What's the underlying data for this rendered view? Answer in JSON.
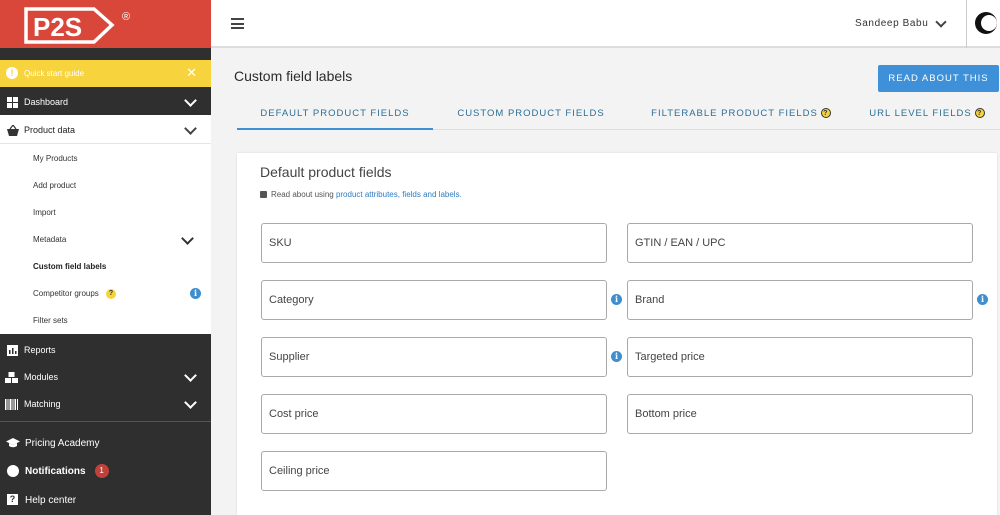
{
  "brand": {
    "logo_text": "P2S",
    "registered_mark": "®",
    "logo_color": "#d9473b"
  },
  "sidebar": {
    "quick_start": {
      "label": "Quick start guide",
      "close": "✕",
      "color": "#f7d43d"
    },
    "dashboard": {
      "label": "Dashboard"
    },
    "product_data": {
      "label": "Product data",
      "items": [
        {
          "label": "My Products"
        },
        {
          "label": "Add product"
        },
        {
          "label": "Import"
        },
        {
          "label": "Metadata"
        },
        {
          "label": "Custom field labels"
        },
        {
          "label": "Competitor groups",
          "help": "?",
          "info": "i"
        },
        {
          "label": "Filter sets"
        }
      ]
    },
    "reports": {
      "label": "Reports"
    },
    "modules": {
      "label": "Modules"
    },
    "matching": {
      "label": "Matching"
    },
    "pricing_academy": {
      "label": "Pricing Academy"
    },
    "notifications": {
      "label": "Notifications",
      "count": "1"
    },
    "help_center": {
      "label": "Help center"
    }
  },
  "topbar": {
    "user_name": "Sandeep Babu"
  },
  "header": {
    "title": "Custom field labels",
    "read_button": "READ ABOUT THIS",
    "accent_color": "#3e90d8"
  },
  "tabs": [
    {
      "label": "DEFAULT PRODUCT FIELDS",
      "active": true
    },
    {
      "label": "CUSTOM PRODUCT FIELDS",
      "active": false
    },
    {
      "label": "FILTERABLE PRODUCT FIELDS",
      "help": "?",
      "active": false
    },
    {
      "label": "URL LEVEL FIELDS",
      "help": "?",
      "active": false
    }
  ],
  "card": {
    "title": "Default product fields",
    "note_prefix": "Read about using ",
    "note_link": "product attributes, fields and labels.",
    "fields": [
      {
        "placeholder": "SKU"
      },
      {
        "placeholder": "GTIN / EAN / UPC"
      },
      {
        "placeholder": "Category",
        "info": "i"
      },
      {
        "placeholder": "Brand",
        "info": "i"
      },
      {
        "placeholder": "Supplier",
        "info": "i"
      },
      {
        "placeholder": "Targeted price"
      },
      {
        "placeholder": "Cost price"
      },
      {
        "placeholder": "Bottom price"
      },
      {
        "placeholder": "Ceiling price"
      }
    ]
  }
}
